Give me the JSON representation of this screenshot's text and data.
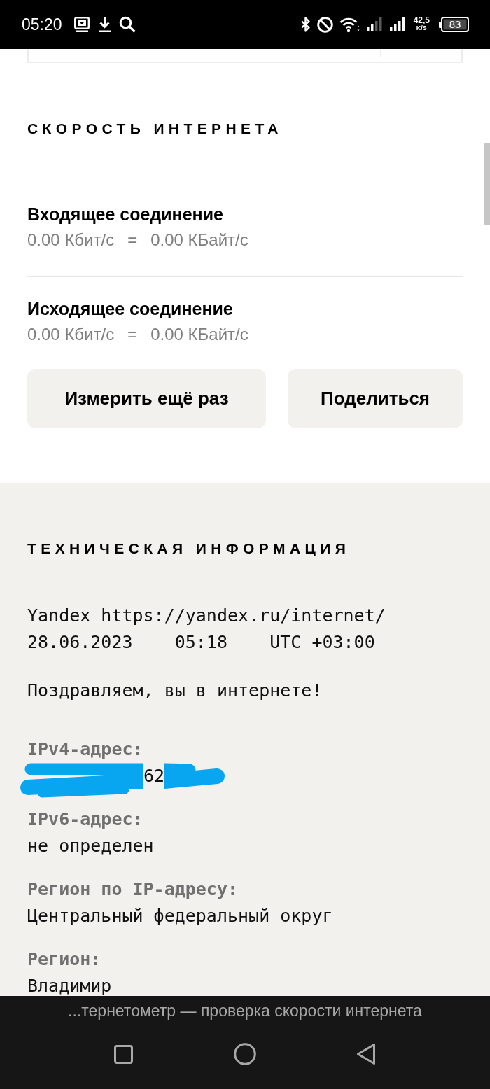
{
  "status_bar": {
    "time": "05:20",
    "network_speed": "42,5",
    "network_speed_unit": "K/S",
    "battery": "83"
  },
  "speed_test": {
    "title": "СКОРОСТЬ ИНТЕРНЕТА",
    "connections": [
      {
        "label": "Входящее соединение",
        "bits_rate": "0.00 Кбит/с",
        "separator": "=",
        "bytes_rate": "0.00 КБайт/с"
      },
      {
        "label": "Исходящее соединение",
        "bits_rate": "0.00 Кбит/с",
        "separator": "=",
        "bytes_rate": "0.00 КБайт/с"
      }
    ],
    "buttons": [
      {
        "label": "Измерить ещё раз"
      },
      {
        "label": "Поделиться"
      }
    ]
  },
  "technical_info": {
    "title": "ТЕХНИЧЕСКАЯ ИНФОРМАЦИЯ",
    "lines": [
      "Yandex https://yandex.ru/internet/",
      "28.06.2023    05:18    UTC +03:00"
    ],
    "message": "Поздравляем, вы в интернете!",
    "fields": [
      {
        "label": "IPv4-адрес:",
        "value": "62",
        "redacted": true
      },
      {
        "label": "IPv6-адрес:",
        "value": "не определен",
        "redacted": false
      },
      {
        "label": "Регион по IP-адресу:",
        "value": "Центральный федеральный округ",
        "redacted": false
      },
      {
        "label": "Регион:",
        "value": "Владимир",
        "redacted": false
      }
    ]
  },
  "browser_bar": {
    "page_title": "...тернетометр — проверка скорости интернета"
  }
}
